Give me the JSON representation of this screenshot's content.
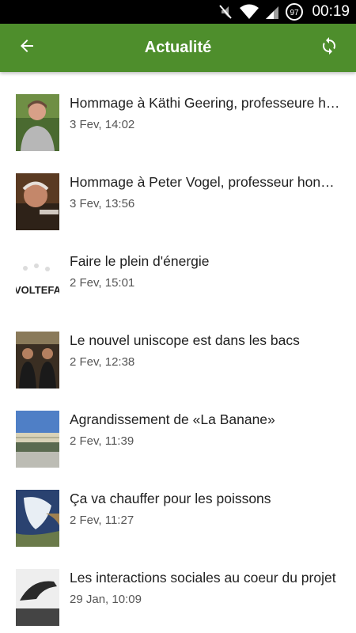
{
  "status_bar": {
    "time": "00:19",
    "battery_level": "97",
    "icons": [
      "mute-icon",
      "wifi-icon",
      "signal-icon",
      "battery-icon"
    ]
  },
  "app_bar": {
    "title": "Actualité",
    "back_icon": "arrow-left-icon",
    "refresh_icon": "refresh-icon",
    "color": "#4e8e2c"
  },
  "news": [
    {
      "title": "Hommage à Käthi Geering, professeure honoraire",
      "date": "3 Fev, 14:02",
      "thumb": "portrait-woman"
    },
    {
      "title": "Hommage à Peter Vogel, professeur honoraire",
      "date": "3 Fev, 13:56",
      "thumb": "portrait-man"
    },
    {
      "title": "Faire le plein d'énergie",
      "date": "2 Fev, 15:01",
      "thumb": "voltefac-logo"
    },
    {
      "title": "Le nouvel uniscope est dans les bacs",
      "date": "2 Fev, 12:38",
      "thumb": "two-people"
    },
    {
      "title": "Agrandissement de «La Banane»",
      "date": "2 Fev, 11:39",
      "thumb": "building"
    },
    {
      "title": "Ça va chauffer pour les poissons",
      "date": "2 Fev, 11:27",
      "thumb": "earth-map"
    },
    {
      "title": "Les interactions sociales au coeur du projet",
      "date": "29 Jan, 10:09",
      "thumb": "hand-bw"
    }
  ]
}
